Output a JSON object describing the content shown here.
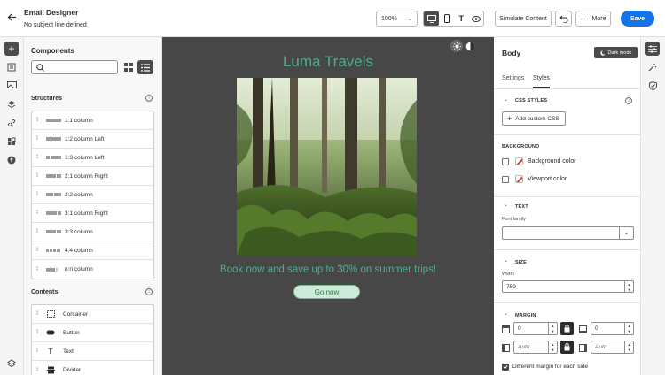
{
  "header": {
    "title": "Email Designer",
    "subtitle": "No subject line defined",
    "zoom": "100%",
    "simulate_label": "Simulate Content",
    "more_label": "More",
    "save_label": "Save"
  },
  "components_panel": {
    "title": "Components",
    "search_placeholder": "",
    "structures_heading": "Structures",
    "structures": [
      {
        "label": "1:1 column"
      },
      {
        "label": "1:2 column Left"
      },
      {
        "label": "1:3 column Left"
      },
      {
        "label": "2:1 column Right"
      },
      {
        "label": "2:2 column"
      },
      {
        "label": "3:1 column Right"
      },
      {
        "label": "3:3 column"
      },
      {
        "label": "4:4 column"
      },
      {
        "label": "n:n column"
      }
    ],
    "contents_heading": "Contents",
    "contents": [
      {
        "label": "Container",
        "icon": "container-icon"
      },
      {
        "label": "Button",
        "icon": "button-icon"
      },
      {
        "label": "Text",
        "icon": "text-icon"
      },
      {
        "label": "Divider",
        "icon": "divider-icon"
      }
    ]
  },
  "canvas": {
    "heading": "Luma Travels",
    "promo": "Book now and save up to 30% on summer trips!",
    "cta": "Go now",
    "colors": {
      "background": "#474747",
      "heading": "#4fae8c",
      "promo": "#4fae8c",
      "cta_bg": "#cdebd6"
    }
  },
  "properties": {
    "title": "Body",
    "dark_mode_label": "Dark mode",
    "tabs": [
      {
        "label": "Settings"
      },
      {
        "label": "Styles"
      }
    ],
    "active_tab": "Styles",
    "css_styles": {
      "heading": "CSS STYLES",
      "add_label": "Add custom CSS"
    },
    "background": {
      "heading": "BACKGROUND",
      "bg_color_label": "Background color",
      "viewport_label": "Viewport color"
    },
    "text": {
      "heading": "TEXT",
      "font_family_label": "Font family",
      "font_family_value": ""
    },
    "size": {
      "heading": "SIZE",
      "width_label": "Width",
      "width_value": "750"
    },
    "margin": {
      "heading": "MARGIN",
      "top": "0",
      "bottom": "0",
      "left": "Auto",
      "right": "Auto",
      "different_label": "Different margin for each side"
    }
  },
  "colors": {
    "accent": "#1473e6",
    "panel_bg": "#f8f8f8"
  }
}
